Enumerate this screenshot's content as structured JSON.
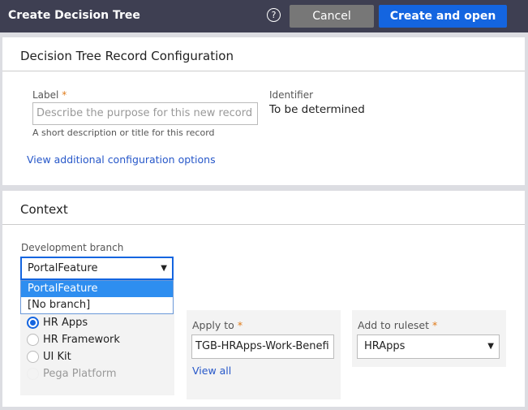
{
  "header": {
    "title": "Create Decision Tree",
    "help_icon": "?",
    "cancel": "Cancel",
    "create": "Create and open"
  },
  "config": {
    "heading": "Decision Tree Record Configuration",
    "label": "Label",
    "required": "*",
    "placeholder": "Describe the purpose for this new record",
    "hint": "A short description or title for this record",
    "identifier_label": "Identifier",
    "identifier_value": "To be determined",
    "more_link": "View additional configuration options"
  },
  "context": {
    "heading": "Context",
    "branch_label": "Development branch",
    "branch_value": "PortalFeature",
    "branch_options": [
      "PortalFeature",
      "[No branch]"
    ],
    "apps": [
      {
        "label": "HR Apps",
        "selected": true
      },
      {
        "label": "HR Framework"
      },
      {
        "label": "UI Kit"
      },
      {
        "label": "Pega Platform",
        "disabled": true
      }
    ],
    "apply_label": "Apply to",
    "apply_value": "TGB-HRApps-Work-Benefi",
    "view_all": "View all",
    "ruleset_label": "Add to ruleset",
    "ruleset_value": "HRApps"
  },
  "colors": {
    "header": "#3e3f52",
    "accent": "#1465e0",
    "required": "#e07b1a"
  }
}
